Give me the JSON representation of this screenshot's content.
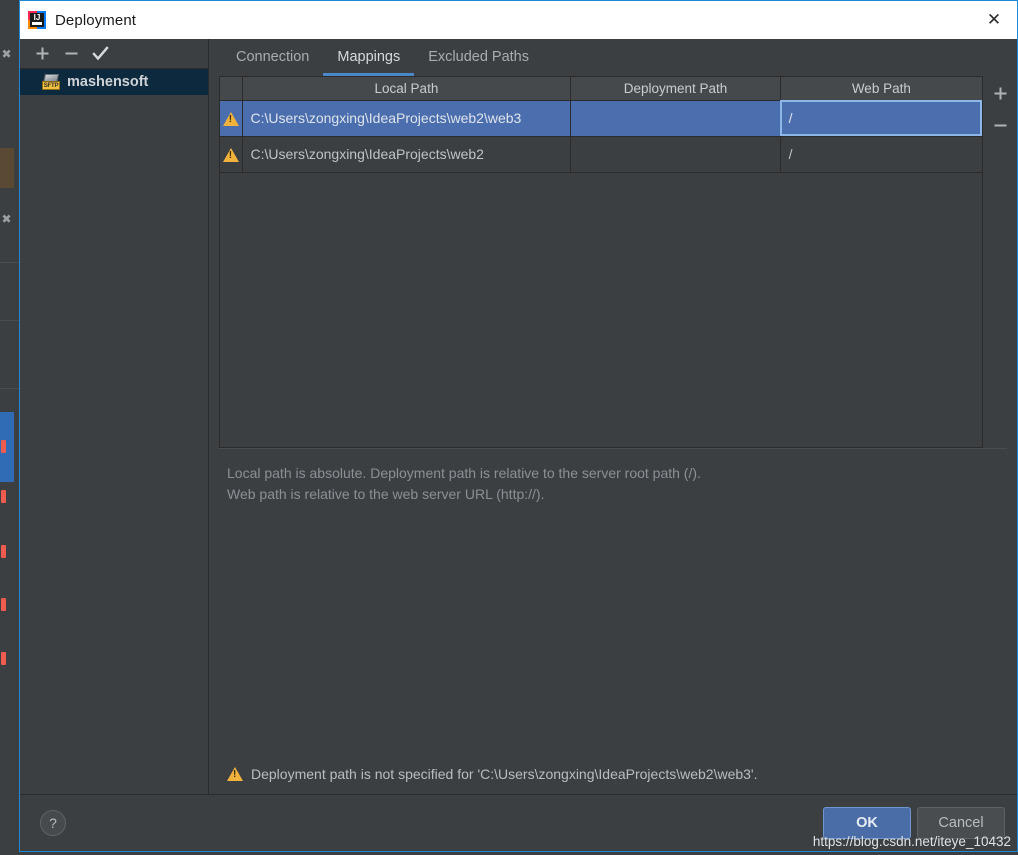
{
  "window": {
    "title": "Deployment",
    "app_icon": "intellij-idea-icon",
    "close_label": "✕"
  },
  "left_panel": {
    "toolbar": {
      "add_label": "+",
      "remove_label": "−",
      "check_label": "✓"
    },
    "servers": [
      {
        "name": "mashensoft",
        "icon": "sftp-server-icon",
        "badge": "SFTP",
        "selected": true
      }
    ]
  },
  "tabs": [
    {
      "label": "Connection",
      "active": false
    },
    {
      "label": "Mappings",
      "active": true
    },
    {
      "label": "Excluded Paths",
      "active": false
    }
  ],
  "table": {
    "columns": [
      "Local Path",
      "Deployment Path",
      "Web Path"
    ],
    "side_buttons": {
      "add_label": "+",
      "remove_label": "−"
    },
    "rows": [
      {
        "warning": true,
        "local_path": "C:\\Users\\zongxing\\IdeaProjects\\web2\\web3",
        "deployment_path": "",
        "web_path": "/",
        "selected": true,
        "focused_cell": "web_path"
      },
      {
        "warning": true,
        "local_path": "C:\\Users\\zongxing\\IdeaProjects\\web2",
        "deployment_path": "",
        "web_path": "/",
        "selected": false,
        "focused_cell": ""
      }
    ]
  },
  "description": {
    "line1": "Local path is absolute. Deployment path is relative to the server root path (/).",
    "line2": "Web path is relative to the web server URL (http://)."
  },
  "warning": {
    "icon": "warning-triangle-icon",
    "text": "Deployment path is not specified for 'C:\\Users\\zongxing\\IdeaProjects\\web2\\web3'."
  },
  "footer": {
    "help_label": "?",
    "ok_label": "OK",
    "cancel_label": "Cancel"
  },
  "watermark": "https://blog.csdn.net/iteye_10432",
  "colors": {
    "dialog_border": "#1e8ad6",
    "background": "#3c3f41",
    "selection_blue": "#4b6eaf",
    "tab_accent": "#4a88c7",
    "warning_amber": "#f2b33d",
    "primary_button": "#4a6da7",
    "sidebar_selected": "#0d293e"
  }
}
